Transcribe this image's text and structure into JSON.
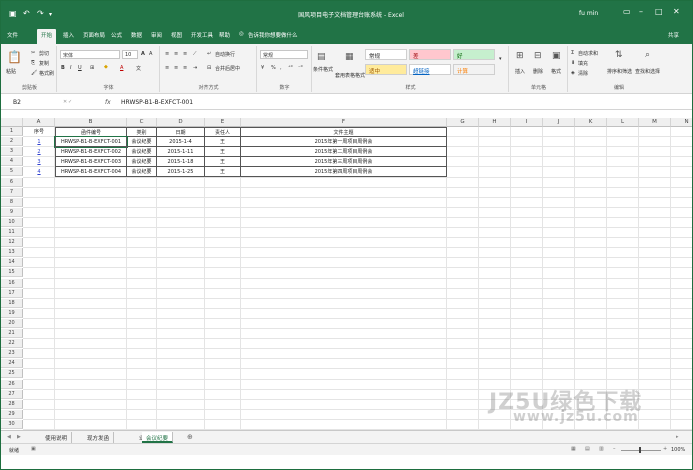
{
  "title": "国风项目电子文档管理台账系统 - Excel",
  "user": "fu min",
  "colors": {
    "brand": "#217346",
    "link": "#2e3fcf"
  },
  "tabs": [
    "文件",
    "开始",
    "插入",
    "页面布局",
    "公式",
    "数据",
    "审阅",
    "视图",
    "开发工具",
    "帮助"
  ],
  "tell_me": "告诉我你想要做什么",
  "share": "共享",
  "ribbon": {
    "clipboard": {
      "paste": "粘贴",
      "cut": "剪切",
      "copy": "复制",
      "format_painter": "格式刷",
      "label": "剪贴板"
    },
    "font": {
      "name": "宋体",
      "size": "10",
      "label": "字体"
    },
    "alignment": {
      "wrap": "自动换行",
      "merge": "合并后居中",
      "label": "对齐方式"
    },
    "number": {
      "format": "常规",
      "label": "数字"
    },
    "styles": {
      "conditional": "条件格式",
      "table": "套用表格格式",
      "regular": "常规",
      "bad": "差",
      "good": "好",
      "neutral": "适中",
      "hyperlink": "超链接",
      "calc": "计算",
      "label": "样式"
    },
    "cells": {
      "insert": "插入",
      "delete": "删除",
      "format": "格式",
      "label": "单元格"
    },
    "editing": {
      "autosum": "自动求和",
      "fill": "填充",
      "clear": "清除",
      "sort": "排序和筛选",
      "find": "查找和选择",
      "label": "编辑"
    }
  },
  "formula_bar": {
    "name_box": "B2",
    "value": "HRWSP-B1-B-EXFCT-001"
  },
  "columns": [
    "A",
    "B",
    "C",
    "D",
    "E",
    "F",
    "G",
    "H",
    "I",
    "J",
    "K",
    "L",
    "M",
    "N"
  ],
  "row_numbers": [
    "1",
    "2",
    "3",
    "4",
    "5",
    "6",
    "7",
    "8",
    "9",
    "10",
    "11",
    "12",
    "13",
    "14",
    "15",
    "16",
    "17",
    "18",
    "19",
    "20",
    "21",
    "22",
    "23",
    "24",
    "25",
    "26",
    "27",
    "28",
    "29",
    "30"
  ],
  "table": {
    "headers": [
      "序号",
      "函件编号",
      "类别",
      "日期",
      "责任人",
      "文件主题"
    ],
    "rows": [
      [
        "1",
        "HRWSP-B1-B-EXFCT-001",
        "会议纪要",
        "2015-1-4",
        "王",
        "2015年第一周项目周例会"
      ],
      [
        "2",
        "HRWSP-B1-B-EXFCT-002",
        "会议纪要",
        "2015-1-11",
        "王",
        "2015年第二周项目周例会"
      ],
      [
        "3",
        "HRWSP-B1-B-EXFCT-003",
        "会议纪要",
        "2015-1-18",
        "王",
        "2015年第三周项目周例会"
      ],
      [
        "4",
        "HRWSP-B1-B-EXFCT-004",
        "会议纪要",
        "2015-1-25",
        "王",
        "2015年第四周项目周例会"
      ]
    ]
  },
  "sheets": [
    "使用说明",
    "现方发函",
    "业主发函",
    "会议纪要"
  ],
  "active_sheet": "会议纪要",
  "status": {
    "ready": "就绪",
    "zoom": "100%"
  },
  "watermark": {
    "line1": "JZ5U绿色下载",
    "line2": "www.jz5u.com"
  }
}
